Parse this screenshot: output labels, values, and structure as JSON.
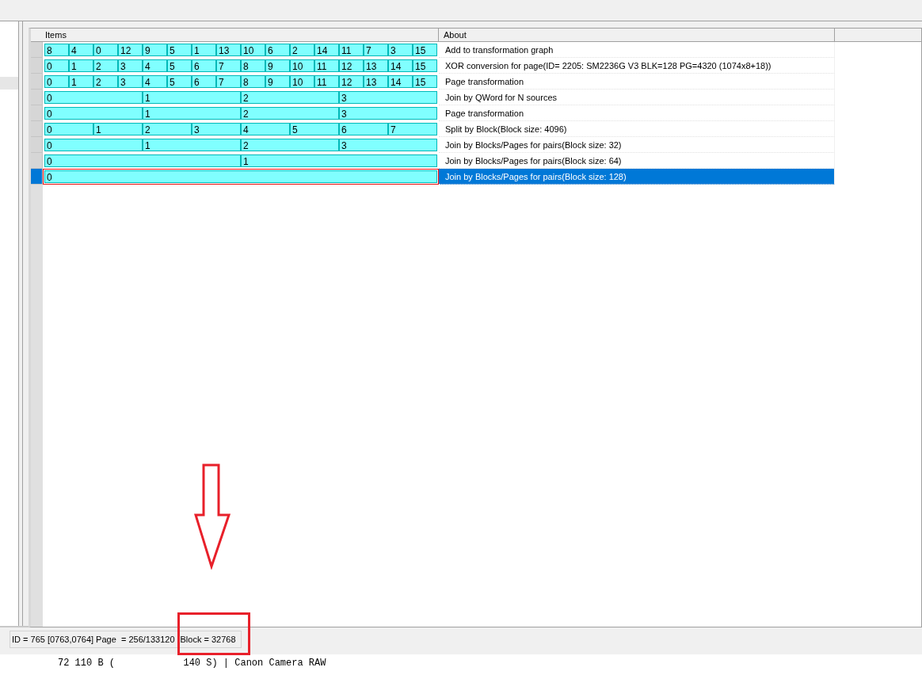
{
  "grid": {
    "columns": [
      "Items",
      "About"
    ],
    "rows": [
      {
        "items": [
          "8",
          "4",
          "0",
          "12",
          "9",
          "5",
          "1",
          "13",
          "10",
          "6",
          "2",
          "14",
          "11",
          "7",
          "3",
          "15"
        ],
        "about": "Add to transformation graph",
        "selected": false
      },
      {
        "items": [
          "0",
          "1",
          "2",
          "3",
          "4",
          "5",
          "6",
          "7",
          "8",
          "9",
          "10",
          "11",
          "12",
          "13",
          "14",
          "15"
        ],
        "about": "XOR conversion for page(ID= 2205: SM2236G V3 BLK=128 PG=4320 (1074x8+18))",
        "selected": false
      },
      {
        "items": [
          "0",
          "1",
          "2",
          "3",
          "4",
          "5",
          "6",
          "7",
          "8",
          "9",
          "10",
          "11",
          "12",
          "13",
          "14",
          "15"
        ],
        "about": "Page transformation",
        "selected": false
      },
      {
        "items": [
          "0",
          "1",
          "2",
          "3"
        ],
        "about": "Join by QWord for N sources",
        "selected": false
      },
      {
        "items": [
          "0",
          "1",
          "2",
          "3"
        ],
        "about": "Page transformation",
        "selected": false
      },
      {
        "items": [
          "0",
          "1",
          "2",
          "3",
          "4",
          "5",
          "6",
          "7"
        ],
        "about": "Split by Block(Block size: 4096)",
        "selected": false
      },
      {
        "items": [
          "0",
          "1",
          "2",
          "3"
        ],
        "about": "Join by Blocks/Pages for pairs(Block size: 32)",
        "selected": false
      },
      {
        "items": [
          "0",
          "1"
        ],
        "about": "Join by Blocks/Pages for pairs(Block size: 64)",
        "selected": false
      },
      {
        "items": [
          "0"
        ],
        "about": "Join by Blocks/Pages for pairs(Block size: 128)",
        "selected": true
      }
    ]
  },
  "status_bar": {
    "id_page": "ID = 765 [0763,0764] Page  = 256/133120",
    "block": "Block = 32768"
  },
  "log_line": "72 110 B (            140 S) | Canon Camera RAW"
}
